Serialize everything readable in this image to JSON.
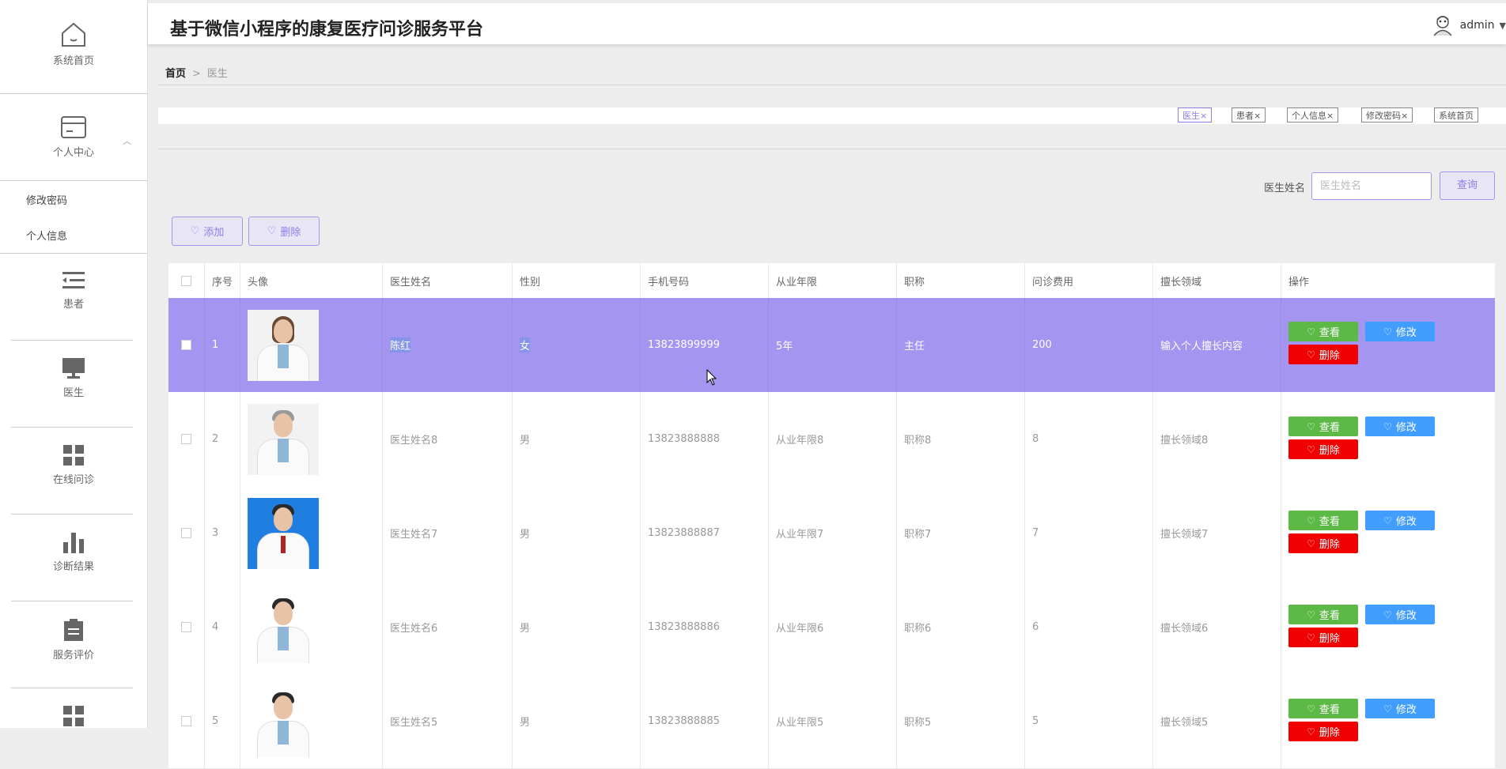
{
  "app": {
    "title": "基于微信小程序的康复医疗问诊服务平台"
  },
  "header": {
    "username": "admin"
  },
  "sidebar": {
    "home": "系统首页",
    "personal": "个人中心",
    "sub_items": [
      "修改密码",
      "个人信息"
    ],
    "items": [
      {
        "label": "患者",
        "icon": "list-icon"
      },
      {
        "label": "医生",
        "icon": "monitor-icon"
      },
      {
        "label": "在线问诊",
        "icon": "grid-icon"
      },
      {
        "label": "诊断结果",
        "icon": "bar-chart-icon"
      },
      {
        "label": "服务评价",
        "icon": "clipboard-icon"
      }
    ]
  },
  "breadcrumb": {
    "home": "首页",
    "separator": ">",
    "current": "医生"
  },
  "tags": [
    {
      "label": "医生×",
      "active": true
    },
    {
      "label": "患者×",
      "active": false
    },
    {
      "label": "个人信息×",
      "active": false
    },
    {
      "label": "修改密码×",
      "active": false
    },
    {
      "label": "系统首页",
      "active": false
    }
  ],
  "search": {
    "label": "医生姓名",
    "placeholder": "医生姓名",
    "value": "",
    "button": "查询"
  },
  "actions": {
    "add": "添加",
    "delete": "删除"
  },
  "table": {
    "columns": [
      "序号",
      "头像",
      "医生姓名",
      "性别",
      "手机号码",
      "从业年限",
      "职称",
      "问诊费用",
      "擅长领域",
      "操作"
    ],
    "rows": [
      {
        "index": "1",
        "name": "陈红",
        "gender": "女",
        "phone": "13823899999",
        "years": "5年",
        "title": "主任",
        "fee": "200",
        "field": "输入个人擅长内容",
        "selected": true
      },
      {
        "index": "2",
        "name": "医生姓名8",
        "gender": "男",
        "phone": "13823888888",
        "years": "从业年限8",
        "title": "职称8",
        "fee": "8",
        "field": "擅长领域8",
        "selected": false
      },
      {
        "index": "3",
        "name": "医生姓名7",
        "gender": "男",
        "phone": "13823888887",
        "years": "从业年限7",
        "title": "职称7",
        "fee": "7",
        "field": "擅长领域7",
        "selected": false
      },
      {
        "index": "4",
        "name": "医生姓名6",
        "gender": "男",
        "phone": "13823888886",
        "years": "从业年限6",
        "title": "职称6",
        "fee": "6",
        "field": "擅长领域6",
        "selected": false
      },
      {
        "index": "5",
        "name": "医生姓名5",
        "gender": "男",
        "phone": "13823888885",
        "years": "从业年限5",
        "title": "职称5",
        "fee": "5",
        "field": "擅长领域5",
        "selected": false
      }
    ],
    "op_labels": {
      "view": "查看",
      "edit": "修改",
      "delete": "删除"
    }
  },
  "colors": {
    "accent": "#a395f0",
    "view": "#5cb946",
    "edit": "#419eff",
    "delete": "#f00000"
  }
}
